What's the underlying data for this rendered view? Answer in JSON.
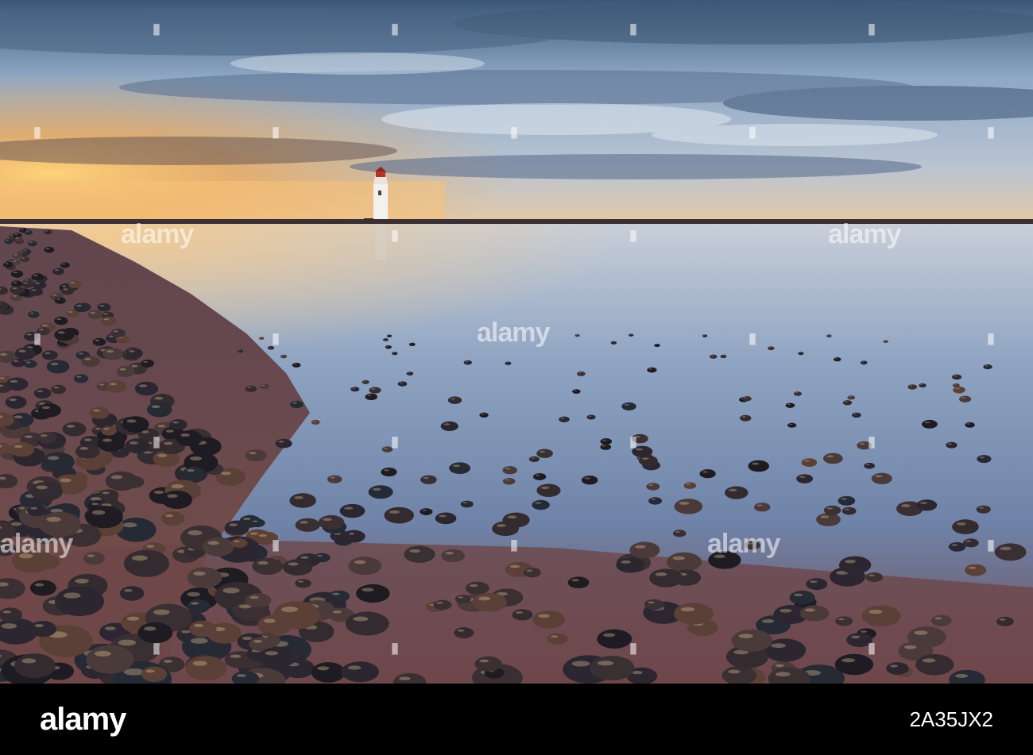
{
  "scene": {
    "subject": "lighthouse-at-dawn-on-pebble-beach",
    "colors": {
      "sky_warm": "#f2a54a",
      "sky_blue": "#7fa3c8",
      "cloud_dark": "#3f5470",
      "water": "#8fa6c4",
      "sand": "#6e4a4a",
      "pebble": "#2a2530"
    }
  },
  "watermark": {
    "text": "alamy",
    "icon": "alamy-stamp"
  },
  "footer": {
    "logo": "alamy",
    "image_id": "2A35JX2"
  }
}
